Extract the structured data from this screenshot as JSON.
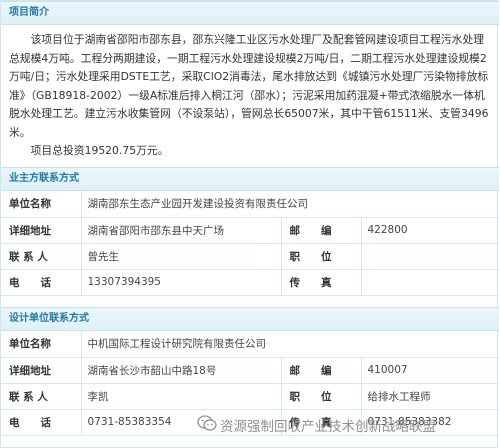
{
  "project_intro": {
    "header": "项目简介",
    "paragraph1": "该项目位于湖南省邵阳市邵东县，邵东兴隆工业区污水处理厂及配套管网建设项目工程污水处理总规模4万吨。工程分两期建设，一期工程污水处理建设规模2万吨/日，二期工程污水处理建设规模2万吨/日；污水处理采用DSTE工艺，采取ClO2消毒法，尾水排放达到《城镇污水处理厂污染物排放标准》（GB18918-2002）一级A标准后排入桐江河（邵水）；污泥采用加药混凝+带式浓缩脱水一体机脱水处理工艺。建立污水收集管网（不设泵站），管网总长65007米，其中干管61511米、支管3496米。",
    "paragraph2": "项目总投资19520.75万元。"
  },
  "owner_contact": {
    "header": "业主方联系方式",
    "unit_label": "单位名称",
    "unit_value": "湖南邵东生态产业园开发建设投资有限责任公司",
    "address_label": "详细地址",
    "address_value": "湖南省邵阳市邵东县中天广场",
    "postcode_label": "邮　　编",
    "postcode_value": "422800",
    "contact_label": "联 系 人",
    "contact_value": "曾先生",
    "position_label": "职　　位",
    "position_value": "",
    "phone_label": "电　　话",
    "phone_value": "13307394395",
    "fax_label": "传　　真",
    "fax_value": ""
  },
  "design_contact": {
    "header": "设计单位联系方式",
    "unit_label": "单位名称",
    "unit_value": "中机国际工程设计研究院有限责任公司",
    "address_label": "详细地址",
    "address_value": "湖南省长沙市韶山中路18号",
    "postcode_label": "邮　　编",
    "postcode_value": "410007",
    "contact_label": "联 系 人",
    "contact_value": "李凯",
    "position_label": "职　　位",
    "position_value": "给排水工程师",
    "phone_label": "电　　话",
    "phone_value": "0731-85383354",
    "fax_label": "传　　真",
    "fax_value": "0731-85383382"
  },
  "watermark": {
    "text": "资源强制回收产业技术创新战略联盟",
    "icon": "wechat-icon"
  },
  "colors": {
    "header_text": "#1f7aa8",
    "header_bg": "#e3f2f8",
    "border": "#d6e9f1"
  }
}
